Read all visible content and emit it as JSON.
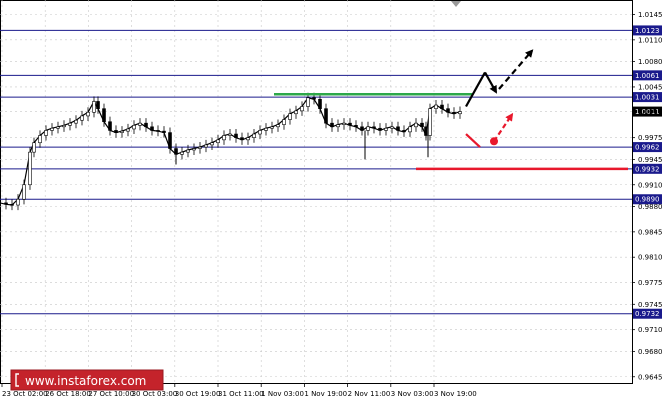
{
  "chart_data": {
    "type": "candlestick",
    "x_ticks": [
      "23 Oct 02:00",
      "26 Oct 18:00",
      "27 Oct 10:00",
      "30 Oct 03:00",
      "30 Oct 19:00",
      "31 Oct 11:00",
      "1 Nov 03:00",
      "1 Nov 19:00",
      "2 Nov 11:00",
      "3 Nov 03:00",
      "3 Nov 19:00"
    ],
    "y_ticks": [
      1.0145,
      1.011,
      1.008,
      1.0045,
      1.0011,
      0.9975,
      0.9945,
      0.991,
      0.988,
      0.9845,
      0.981,
      0.9775,
      0.9745,
      0.971,
      0.968,
      0.9645
    ],
    "ylim": [
      0.9635,
      1.0165
    ],
    "levels": [
      {
        "value": 1.0123,
        "label": "1.0123"
      },
      {
        "value": 1.0061,
        "label": "1.0061"
      },
      {
        "value": 1.0031,
        "label": "1.0031"
      },
      {
        "value": 0.9962,
        "label": "0.9962"
      },
      {
        "value": 0.9932,
        "label": "0.9932"
      },
      {
        "value": 0.989,
        "label": "0.9890"
      },
      {
        "value": 0.9732,
        "label": "0.9732"
      }
    ],
    "current_price": {
      "value": 1.0011,
      "label": "1.0011"
    },
    "close_path": [
      [
        0,
        0.9885
      ],
      [
        6,
        0.9883
      ],
      [
        12,
        0.9882
      ],
      [
        18,
        0.989
      ],
      [
        24,
        0.991
      ],
      [
        30,
        0.9955
      ],
      [
        34,
        0.9968
      ],
      [
        40,
        0.9978
      ],
      [
        46,
        0.9985
      ],
      [
        52,
        0.9988
      ],
      [
        58,
        0.999
      ],
      [
        64,
        0.9992
      ],
      [
        70,
        0.9995
      ],
      [
        76,
        0.9999
      ],
      [
        82,
        1.0005
      ],
      [
        88,
        1.001
      ],
      [
        94,
        1.0025
      ],
      [
        98,
        1.0015
      ],
      [
        104,
        0.9997
      ],
      [
        110,
        0.9985
      ],
      [
        116,
        0.9982
      ],
      [
        122,
        0.9984
      ],
      [
        128,
        0.9987
      ],
      [
        134,
        0.9992
      ],
      [
        140,
        0.9995
      ],
      [
        146,
        0.999
      ],
      [
        152,
        0.9985
      ],
      [
        158,
        0.9984
      ],
      [
        164,
        0.9982
      ],
      [
        170,
        0.996
      ],
      [
        176,
        0.9952
      ],
      [
        182,
        0.9955
      ],
      [
        188,
        0.9958
      ],
      [
        194,
        0.996
      ],
      [
        200,
        0.9962
      ],
      [
        206,
        0.9965
      ],
      [
        212,
        0.9968
      ],
      [
        218,
        0.9972
      ],
      [
        224,
        0.9978
      ],
      [
        230,
        0.998
      ],
      [
        236,
        0.9975
      ],
      [
        242,
        0.9972
      ],
      [
        248,
        0.9975
      ],
      [
        254,
        0.998
      ],
      [
        260,
        0.9985
      ],
      [
        266,
        0.9988
      ],
      [
        272,
        0.999
      ],
      [
        278,
        0.9993
      ],
      [
        284,
        1.0
      ],
      [
        290,
        1.0008
      ],
      [
        296,
        1.0012
      ],
      [
        302,
        1.0018
      ],
      [
        308,
        1.003
      ],
      [
        314,
        1.0028
      ],
      [
        320,
        1.0015
      ],
      [
        326,
        0.9995
      ],
      [
        332,
        0.999
      ],
      [
        338,
        0.9993
      ],
      [
        344,
        0.9995
      ],
      [
        350,
        0.9992
      ],
      [
        356,
        0.999
      ],
      [
        362,
        0.9985
      ],
      [
        368,
        0.999
      ],
      [
        374,
        0.9988
      ],
      [
        380,
        0.9985
      ],
      [
        386,
        0.9988
      ],
      [
        392,
        0.999
      ],
      [
        398,
        0.9985
      ],
      [
        404,
        0.9983
      ],
      [
        410,
        0.999
      ],
      [
        416,
        0.9995
      ],
      [
        422,
        0.999
      ],
      [
        426,
        0.9978
      ],
      [
        430,
        1.0015
      ],
      [
        436,
        1.002
      ],
      [
        442,
        1.0015
      ],
      [
        448,
        1.001
      ],
      [
        454,
        1.0008
      ],
      [
        460,
        1.0011
      ]
    ],
    "spikes": [
      [
        365,
        0.9945
      ],
      [
        428,
        0.9948
      ],
      [
        176,
        0.9938
      ]
    ],
    "resistance_line": {
      "value": 1.0035,
      "x_start": 274,
      "x_end": 472
    },
    "support_line": {
      "value": 0.9932,
      "x_start": 416,
      "x_end": 628
    },
    "scenarios": [
      {
        "kind": "bullish",
        "points": [
          [
            466,
            1.0018
          ],
          [
            485,
            1.0065
          ],
          [
            496,
            1.0038
          ],
          [
            532,
            1.0095
          ]
        ]
      },
      {
        "kind": "bearish",
        "points": [
          [
            466,
            0.998
          ],
          [
            480,
            0.9962
          ]
        ]
      },
      {
        "kind": "bearish-arrow",
        "points": [
          [
            494,
            0.997
          ],
          [
            512,
            1.0007
          ]
        ]
      }
    ]
  },
  "watermark": {
    "text": "www.instaforex.com"
  },
  "colors": {
    "levels": "#1a1a8c",
    "badge_bg": "#1a1a8c",
    "current_price_bg": "#000000",
    "resistance": "#2ea84a",
    "support": "#e8182c",
    "candles": "#000000",
    "watermark_bg": "#c4232b"
  }
}
